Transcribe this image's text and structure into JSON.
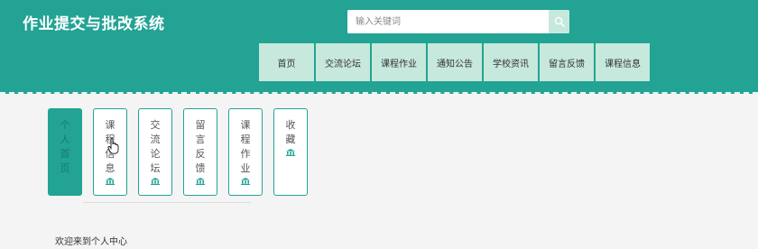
{
  "site": {
    "title": "作业提交与批改系统"
  },
  "search": {
    "placeholder": "输入关键词"
  },
  "nav": [
    "首页",
    "交流论坛",
    "课程作业",
    "通知公告",
    "学校资讯",
    "留言反馈",
    "课程信息"
  ],
  "menu": [
    {
      "label": "个人首页",
      "active": true,
      "has_icon": false
    },
    {
      "label": "课程信息",
      "active": false,
      "has_icon": true
    },
    {
      "label": "交流论坛",
      "active": false,
      "has_icon": true
    },
    {
      "label": "留言反馈",
      "active": false,
      "has_icon": true
    },
    {
      "label": "课程作业",
      "active": false,
      "has_icon": true
    },
    {
      "label": "收藏",
      "active": false,
      "has_icon": true
    }
  ],
  "welcome": "欢迎来到个人中心",
  "colors": {
    "primary": "#22a394",
    "nav_bg": "#c7e8dc"
  },
  "icons": {
    "search": "search-icon",
    "menu": "bank-icon"
  }
}
